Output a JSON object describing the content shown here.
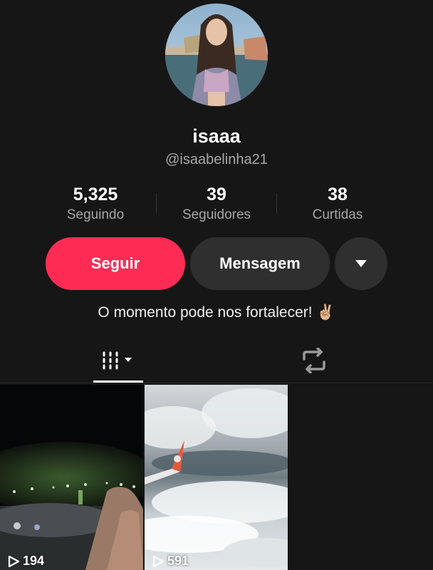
{
  "profile": {
    "display_name": "isaaa",
    "username": "@isaabelinha21",
    "bio": "O momento pode nos fortalecer! ✌🏼"
  },
  "stats": [
    {
      "value": "5,325",
      "label": "Seguindo"
    },
    {
      "value": "39",
      "label": "Seguidores"
    },
    {
      "value": "38",
      "label": "Curtidas"
    }
  ],
  "actions": {
    "follow": "Seguir",
    "message": "Mensagem"
  },
  "tabs": {
    "active": "videos",
    "items": [
      {
        "id": "videos",
        "icon": "grid-lines-icon"
      },
      {
        "id": "reposts",
        "icon": "repost-icon"
      }
    ]
  },
  "videos": [
    {
      "views": "194",
      "icon": "play-icon"
    },
    {
      "views": "591",
      "icon": "play-icon"
    }
  ],
  "colors": {
    "background": "#161616",
    "accent": "#fe2c55",
    "secondary_button": "#2f2f2f",
    "muted_text": "#a7a7a7"
  }
}
